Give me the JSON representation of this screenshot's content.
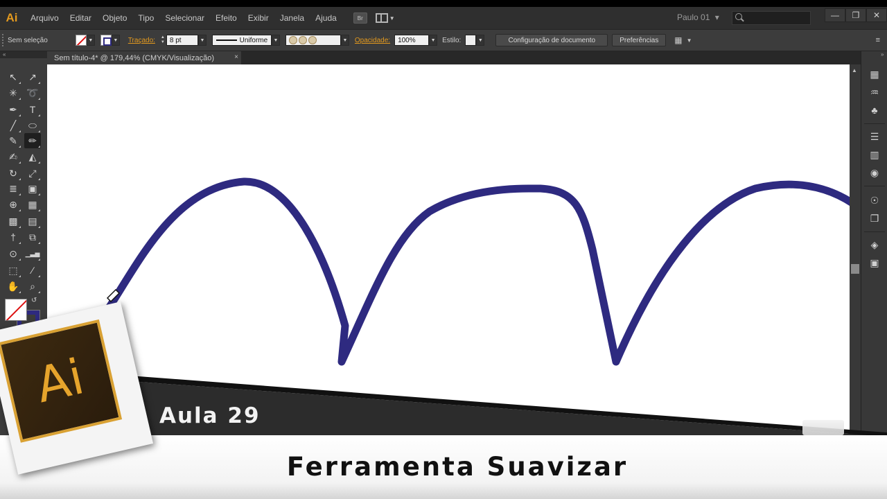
{
  "app": {
    "logo_text": "Ai",
    "menu": [
      "Arquivo",
      "Editar",
      "Objeto",
      "Tipo",
      "Selecionar",
      "Efeito",
      "Exibir",
      "Janela",
      "Ajuda"
    ],
    "bridge_label": "Br",
    "user": "Paulo 01",
    "user_arrow": "▾",
    "window_buttons": [
      "—",
      "❐",
      "✕"
    ]
  },
  "control": {
    "selection": "Sem seleção",
    "stroke_label": "Traçado:",
    "stroke_weight": "8 pt",
    "profile": "Uniforme",
    "opacity_label": "Opacidade:",
    "opacity": "100%",
    "style_label": "Estilo:",
    "doc_setup": "Configuração de documento",
    "prefs": "Preferências"
  },
  "document": {
    "tab_title": "Sem título-4* @ 179,44% (CMYK/Visualização)",
    "close": "×",
    "stroke_color": "#2e2a80"
  },
  "tools": [
    {
      "name": "selection-tool",
      "glyph": "↖"
    },
    {
      "name": "direct-selection-tool",
      "glyph": "↗"
    },
    {
      "name": "magic-wand-tool",
      "glyph": "✳"
    },
    {
      "name": "lasso-tool",
      "glyph": "➰"
    },
    {
      "name": "pen-tool",
      "glyph": "✒"
    },
    {
      "name": "type-tool",
      "glyph": "T"
    },
    {
      "name": "line-tool",
      "glyph": "╱"
    },
    {
      "name": "ellipse-tool",
      "glyph": "⬭"
    },
    {
      "name": "paintbrush-tool",
      "glyph": "✎"
    },
    {
      "name": "smooth-tool",
      "glyph": "✏"
    },
    {
      "name": "blob-brush-tool",
      "glyph": "✍"
    },
    {
      "name": "eraser-tool",
      "glyph": "◭"
    },
    {
      "name": "rotate-tool",
      "glyph": "↻"
    },
    {
      "name": "scale-tool",
      "glyph": "⤢"
    },
    {
      "name": "width-tool",
      "glyph": "≣"
    },
    {
      "name": "free-transform-tool",
      "glyph": "▣"
    },
    {
      "name": "shape-builder-tool",
      "glyph": "⊕"
    },
    {
      "name": "perspective-grid-tool",
      "glyph": "▦"
    },
    {
      "name": "mesh-tool",
      "glyph": "▩"
    },
    {
      "name": "gradient-tool",
      "glyph": "▤"
    },
    {
      "name": "eyedropper-tool",
      "glyph": "†"
    },
    {
      "name": "blend-tool",
      "glyph": "⧉"
    },
    {
      "name": "symbol-sprayer-tool",
      "glyph": "⊙"
    },
    {
      "name": "column-graph-tool",
      "glyph": "▁▃▅"
    },
    {
      "name": "artboard-tool",
      "glyph": "⬚"
    },
    {
      "name": "slice-tool",
      "glyph": "∕"
    },
    {
      "name": "hand-tool",
      "glyph": "✋"
    },
    {
      "name": "zoom-tool",
      "glyph": "⌕"
    }
  ],
  "right_panel_icons": [
    "▦",
    "♒",
    "♣",
    "☰",
    "▥",
    "◉",
    "☉",
    "❐",
    "◈",
    "▣"
  ],
  "overlay": {
    "lesson": "Aula 29",
    "topic": "Ferramenta Suavizar",
    "logo": "Ai"
  }
}
